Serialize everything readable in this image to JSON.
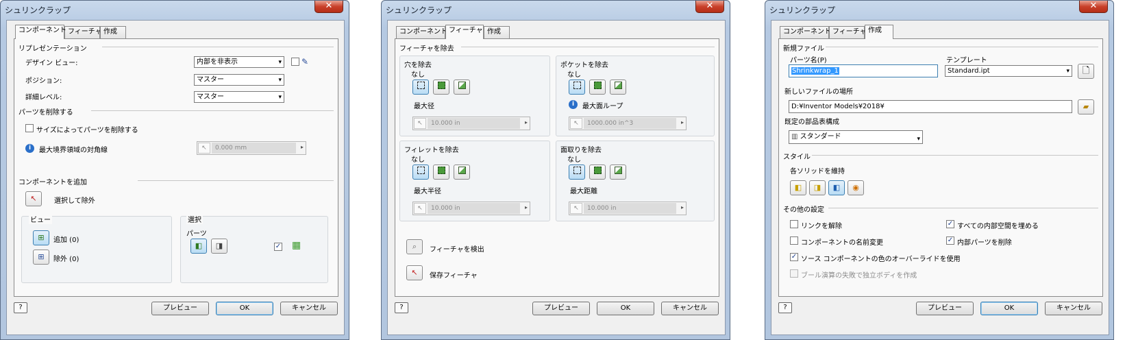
{
  "dialog_title": "シュリンクラップ",
  "close_glyph": "✕",
  "tabs": {
    "component": "コンポーネント",
    "feature": "フィーチャ",
    "create": "作成"
  },
  "buttons": {
    "help": "?",
    "preview": "プレビュー",
    "ok": "OK",
    "cancel": "キャンセル"
  },
  "icons": {
    "arrow": "▾",
    "play": "▸",
    "check": "✓",
    "cursor": "↖",
    "info": "i"
  },
  "d1": {
    "rep": "リプレゼンテーション",
    "design_view_label": "デザイン ビュー:",
    "design_view_value": "内部を非表示",
    "position_label": "ポジション:",
    "position_value": "マスター",
    "lod_label": "詳細レベル:",
    "lod_value": "マスター",
    "remove_parts": "パーツを削除する",
    "remove_by_size": "サイズによってパーツを削除する",
    "max_diag": "最大境界領域の対角線",
    "max_diag_value": "0.000 mm",
    "add_comp": "コンポーネントを追加",
    "select_exclude": "選択して除外",
    "view": "ビュー",
    "add": "追加 (0)",
    "exclude": "除外 (0)",
    "selection": "選択",
    "parts": "パーツ"
  },
  "d2": {
    "remove_features": "フィーチャを除去",
    "holes": "穴を除去",
    "holes_none": "なし",
    "holes_max": "最大径",
    "holes_value": "10.000 in",
    "pockets": "ポケットを除去",
    "pockets_none": "なし",
    "pockets_max": "最大面ループ",
    "pockets_value": "1000.000 in^3",
    "fillets": "フィレットを除去",
    "fillets_none": "なし",
    "fillets_max": "最大半径",
    "fillets_value": "10.000 in",
    "chamfers": "面取りを除去",
    "chamfers_none": "なし",
    "chamfers_max": "最大距離",
    "chamfers_value": "10.000 in",
    "detect": "フィーチャを検出",
    "keep": "保存フィーチャ"
  },
  "d3": {
    "new_file": "新規ファイル",
    "part_name_label": "パーツ名(P)",
    "part_name_value": "Shrinkwrap_1",
    "template_label": "テンプレート",
    "template_value": "Standard.ipt",
    "location_label": "新しいファイルの場所",
    "location_value": "D:¥Inventor Models¥2018¥",
    "bom_label": "既定の部品表構成",
    "bom_value": "スタンダード",
    "style": "スタイル",
    "keep_solids": "各ソリッドを維持",
    "other": "その他の設定",
    "break_link": "リンクを解除",
    "rename": "コンポーネントの名前変更",
    "override_color": "ソース コンポーネントの色のオーバーライドを使用",
    "boolean_fail": "ブール演算の失敗で独立ボディを作成",
    "fill_voids": "すべての内部空間を埋める",
    "remove_internal": "内部パーツを削除"
  }
}
